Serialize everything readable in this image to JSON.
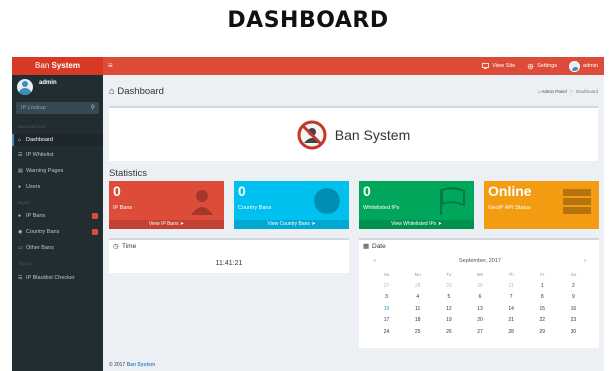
{
  "heading": "DASHBOARD",
  "brand": {
    "first": "Ban ",
    "second": "System"
  },
  "topnav": {
    "hamburger": "≡",
    "view_site": "View Site",
    "settings": "Settings",
    "user": "admin"
  },
  "sidebar": {
    "user_name": "admin",
    "search_placeholder": "IP Lookup",
    "headers": {
      "navigation": "NAVIGATION",
      "bans": "BANS",
      "tools": "TOOLS"
    },
    "items": [
      {
        "label": "Dashboard",
        "icon": "home-icon"
      },
      {
        "label": "IP Whitelist",
        "icon": "list-icon"
      },
      {
        "label": "Warning Pages",
        "icon": "file-icon"
      },
      {
        "label": "Users",
        "icon": "users-icon"
      },
      {
        "label": "IP Bans",
        "icon": "user-icon"
      },
      {
        "label": "Country Bans",
        "icon": "globe-icon"
      },
      {
        "label": "Other Bans",
        "icon": "desktop-icon"
      },
      {
        "label": "IP Blacklist Checker",
        "icon": "list-icon"
      }
    ]
  },
  "page": {
    "title": "Dashboard",
    "breadcrumb": {
      "home": "Admin Panel",
      "current": "Dashboard"
    },
    "banner_title": "Ban System",
    "statistics_title": "Statistics"
  },
  "stats": [
    {
      "number": "0",
      "label": "IP Bans",
      "footer": "View IP Bans",
      "color": "#dd4b39",
      "icon": "user-icon"
    },
    {
      "number": "0",
      "label": "Country Bans",
      "footer": "View Country Bans",
      "color": "#00c0ef",
      "icon": "globe-icon"
    },
    {
      "number": "0",
      "label": "Whitelisted IPs",
      "footer": "View Whitelisted IPs",
      "color": "#00a65a",
      "icon": "flag-icon"
    },
    {
      "number": "Online",
      "label": "GeoIP API Status",
      "footer": "",
      "color": "#f39c12",
      "icon": "server-icon"
    }
  ],
  "time_panel": {
    "title": "Time",
    "value": "11:41:21"
  },
  "date_panel": {
    "title": "Date",
    "month": "September, 2017",
    "dow": [
      "Su",
      "Mo",
      "Tu",
      "We",
      "Th",
      "Fr",
      "Sa"
    ],
    "weeks": [
      [
        "27",
        "28",
        "29",
        "30",
        "31",
        "1",
        "2"
      ],
      [
        "3",
        "4",
        "5",
        "6",
        "7",
        "8",
        "9"
      ],
      [
        "10",
        "11",
        "12",
        "13",
        "14",
        "15",
        "16"
      ],
      [
        "17",
        "18",
        "19",
        "20",
        "21",
        "22",
        "23"
      ],
      [
        "24",
        "25",
        "26",
        "27",
        "28",
        "29",
        "30"
      ]
    ]
  },
  "footer": {
    "copyright": "© 2017 ",
    "brand": "Ban System"
  }
}
